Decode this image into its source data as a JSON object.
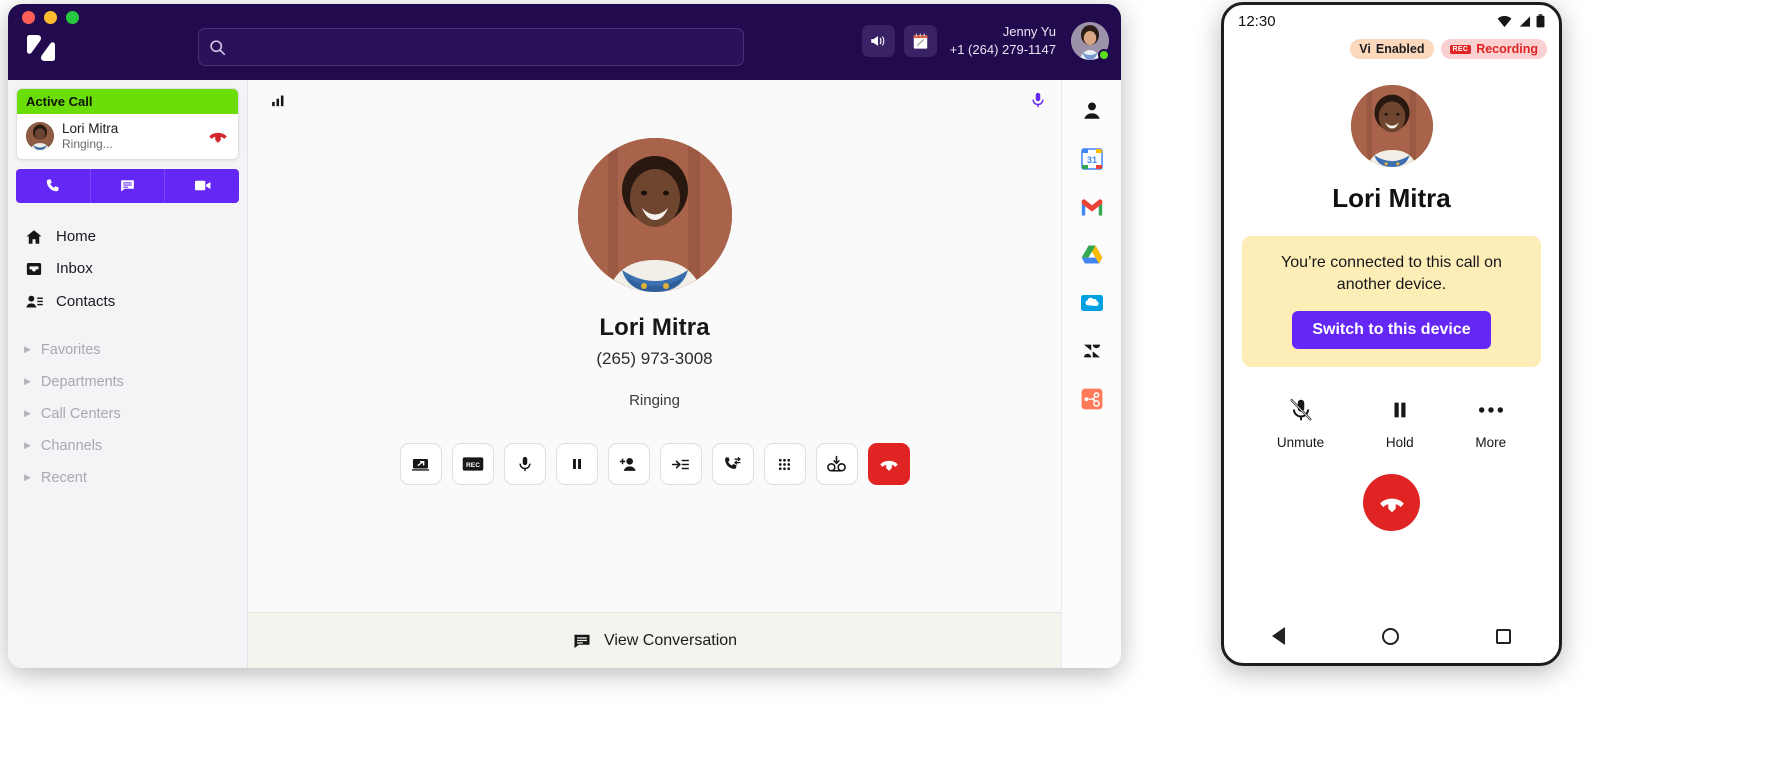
{
  "desktop": {
    "window_controls": [
      "close",
      "minimize",
      "maximize"
    ],
    "brand": "dialpad-logo",
    "search": {
      "value": "",
      "placeholder": ""
    },
    "header": {
      "announcement_icon": "megaphone-icon",
      "notes_icon": "notepad-icon",
      "user_name": "Jenny Yu",
      "user_phone": "+1 (264) 279-1147",
      "presence": "available"
    },
    "sidebar": {
      "active_call": {
        "header": "Active Call",
        "contact": "Lori Mitra",
        "status": "Ringing...",
        "end_call_icon": "end-call-icon"
      },
      "quick_actions": [
        {
          "name": "call",
          "icon": "phone-icon"
        },
        {
          "name": "message",
          "icon": "message-icon"
        },
        {
          "name": "video",
          "icon": "video-icon"
        }
      ],
      "nav_items": [
        {
          "label": "Home",
          "icon": "home-icon"
        },
        {
          "label": "Inbox",
          "icon": "inbox-icon"
        },
        {
          "label": "Contacts",
          "icon": "contacts-icon"
        }
      ],
      "groups": [
        {
          "label": "Favorites"
        },
        {
          "label": "Departments"
        },
        {
          "label": "Call Centers"
        },
        {
          "label": "Channels"
        },
        {
          "label": "Recent"
        }
      ]
    },
    "call": {
      "signal_icon": "signal-bars-icon",
      "mic_icon": "microphone-icon",
      "name": "Lori Mitra",
      "phone": "(265) 973-3008",
      "status": "Ringing",
      "controls": [
        {
          "name": "screen-share",
          "icon": "screen-share-icon"
        },
        {
          "name": "record",
          "icon": "record-icon",
          "label": "REC"
        },
        {
          "name": "mute",
          "icon": "microphone-icon"
        },
        {
          "name": "hold",
          "icon": "pause-icon"
        },
        {
          "name": "add-participant",
          "icon": "add-person-icon"
        },
        {
          "name": "transfer-to-queue",
          "icon": "move-to-list-icon"
        },
        {
          "name": "transfer-call",
          "icon": "call-transfer-icon"
        },
        {
          "name": "dialpad",
          "icon": "dialpad-icon"
        },
        {
          "name": "send-to-voicemail",
          "icon": "voicemail-icon"
        },
        {
          "name": "end-call",
          "icon": "end-call-icon"
        }
      ],
      "footer_label": "View Conversation",
      "footer_icon": "message-icon"
    },
    "app_rail": [
      {
        "name": "contact",
        "icon": "person-icon"
      },
      {
        "name": "google-calendar",
        "icon": "calendar-icon",
        "day": "31"
      },
      {
        "name": "gmail",
        "icon": "gmail-icon"
      },
      {
        "name": "google-drive",
        "icon": "drive-icon"
      },
      {
        "name": "salesforce",
        "icon": "salesforce-icon"
      },
      {
        "name": "zendesk",
        "icon": "zendesk-icon"
      },
      {
        "name": "hubspot",
        "icon": "hubspot-icon"
      }
    ]
  },
  "phone": {
    "status_bar": {
      "time": "12:30",
      "icons": [
        "wifi-icon",
        "signal-icon",
        "battery-icon"
      ]
    },
    "badges": [
      {
        "name": "vi-enabled",
        "mark": "Vi",
        "label": "Enabled"
      },
      {
        "name": "recording",
        "mark": "REC",
        "label": "Recording"
      }
    ],
    "contact_name": "Lori Mitra",
    "notice": {
      "text": "You’re connected to this call on another device.",
      "button": "Switch to this device"
    },
    "controls": [
      {
        "name": "unmute",
        "label": "Unmute",
        "icon": "mic-off-icon"
      },
      {
        "name": "hold",
        "label": "Hold",
        "icon": "pause-icon"
      },
      {
        "name": "more",
        "label": "More",
        "icon": "more-horizontal-icon"
      }
    ],
    "hangup_icon": "end-call-icon",
    "nav_bar": [
      {
        "name": "back",
        "icon": "back-triangle-icon"
      },
      {
        "name": "home",
        "icon": "home-circle-icon"
      },
      {
        "name": "recents",
        "icon": "recents-square-icon"
      }
    ]
  },
  "colors": {
    "brand_purple": "#6427f5",
    "header_bg": "#220a4e",
    "active_green": "#6bdd09",
    "danger_red": "#e02424",
    "notice_bg": "#fdeeb8"
  }
}
